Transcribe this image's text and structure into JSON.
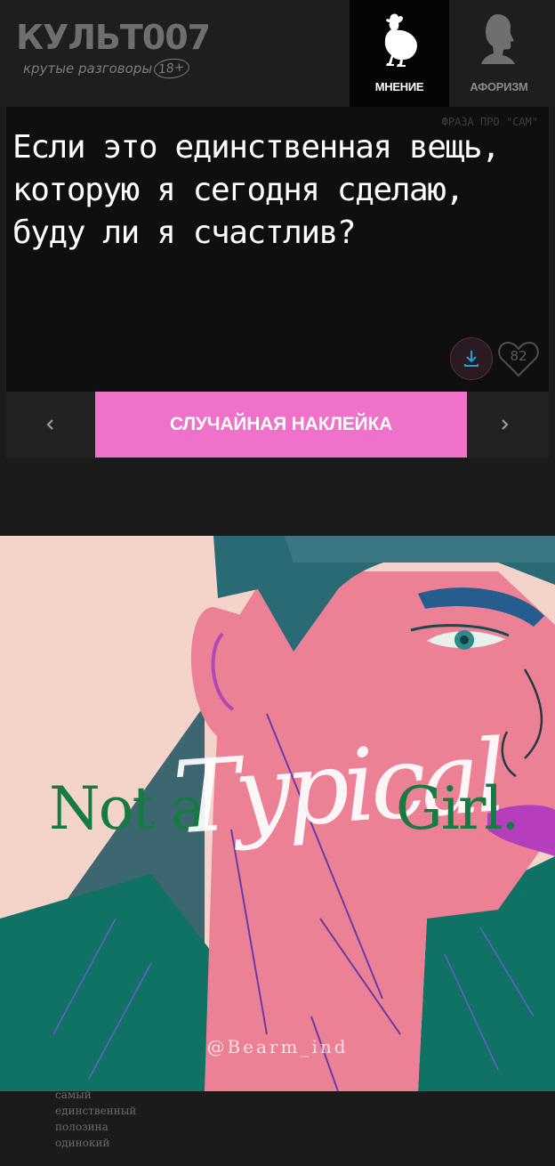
{
  "header": {
    "logo_title": "КУЛЬТ007",
    "logo_subtitle": "крутые разговоры",
    "logo_age": "18+",
    "tabs": [
      {
        "label": "МНЕНИЕ",
        "icon": "chicken-icon",
        "active": true
      },
      {
        "label": "АФОРИЗМ",
        "icon": "head-silhouette-icon",
        "active": false
      }
    ]
  },
  "quote": {
    "tag": "ФРАЗА ПРО \"САМ\"",
    "text": "Если это единственная вещь, которую я сегодня сделаю, буду ли я счастлив?",
    "download_icon": "download-icon",
    "like_icon": "heart-icon",
    "likes": "82"
  },
  "sticker_bar": {
    "prev_icon": "chevron-left-icon",
    "next_icon": "chevron-right-icon",
    "random_label": "СЛУЧАЙНАЯ НАКЛЕЙКА",
    "accent": "#f071c9"
  },
  "artwork": {
    "text_left": "Not a",
    "text_script": "Typical",
    "text_right": "Girl.",
    "credit": "@Bearm_ind"
  },
  "tags": [
    "самый",
    "единственный",
    "полозина",
    "одинокий"
  ]
}
